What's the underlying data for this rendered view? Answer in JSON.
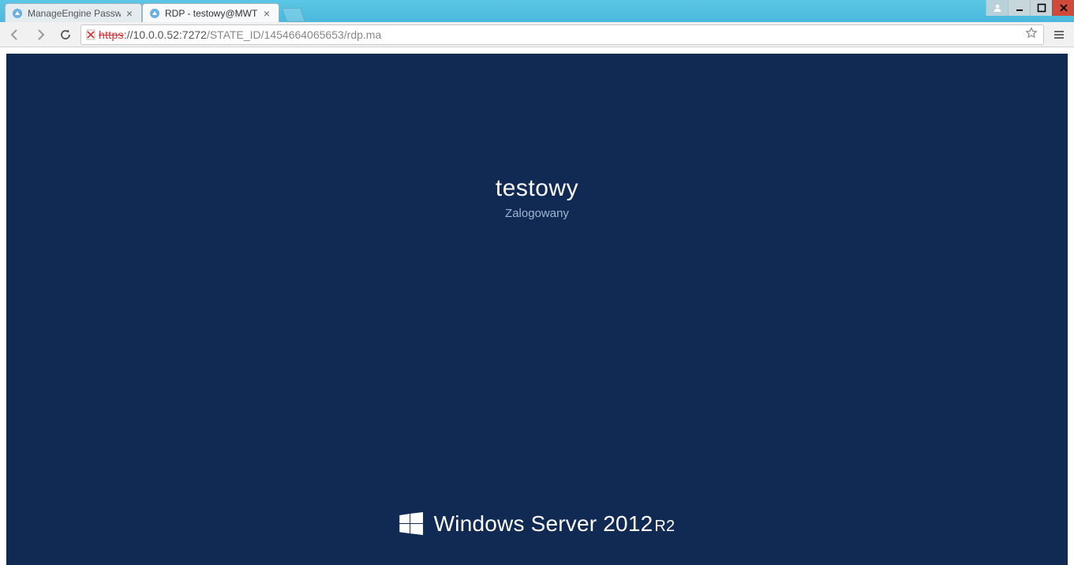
{
  "window": {
    "tabs": [
      {
        "title": "ManageEngine Password M"
      },
      {
        "title": "RDP - testowy@MWTS_VIR"
      }
    ]
  },
  "toolbar": {
    "url_scheme": "https",
    "url_hostport": "://10.0.0.52:7272",
    "url_path": "/STATE_ID/1454664065653/rdp.ma"
  },
  "rdp": {
    "username": "testowy",
    "status": "Zalogowany",
    "brand_main": "Windows Server 2012",
    "brand_suffix": "R2"
  }
}
